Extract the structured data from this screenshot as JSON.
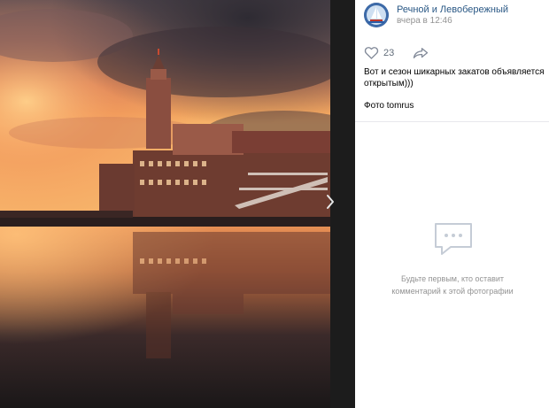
{
  "post": {
    "author": "Речной и Левобережный",
    "time": "вчера в 12:46",
    "likes": "23",
    "caption": "Вот и сезон шикарных закатов объявляется открытым)))",
    "credit": "Фото tomrus"
  },
  "comments": {
    "empty_line1": "Будьте первым, кто оставит",
    "empty_line2": "комментарий к этой фотографии"
  },
  "colors": {
    "link": "#2a5885",
    "muted": "#939393",
    "viewer_bg": "#1f1f1f"
  },
  "icons": [
    "heart-icon",
    "share-icon",
    "chevron-right-icon",
    "comment-bubble-icon"
  ]
}
